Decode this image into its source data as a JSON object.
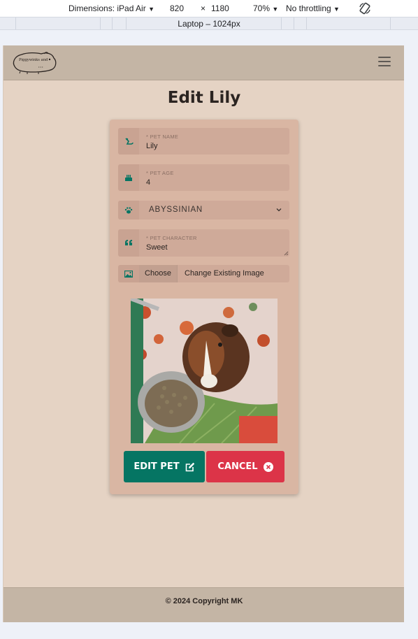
{
  "devtools": {
    "device": "Dimensions: iPad Air",
    "width": "820",
    "times": "×",
    "height": "1180",
    "zoom": "70%",
    "throttling": "No throttling",
    "media_label": "Laptop – 1024px"
  },
  "app": {
    "logo_text": "Piggywinks and",
    "title": "Edit Lily",
    "accent_color": "#057563",
    "danger_color": "#dc3448",
    "form": {
      "name_label": "* PET NAME",
      "name_value": "Lily",
      "age_label": "* PET AGE",
      "age_value": "4",
      "breed_selected": "ABYSSINIAN",
      "character_label": "* PET CHARACTER",
      "character_value": "Sweet",
      "choose_label": "Choose",
      "image_text": "Change Existing Image"
    },
    "photo_icon": "guinea-pig-photo",
    "edit_button": "EDIT PET",
    "cancel_button": "CANCEL",
    "footer_text": "© 2024 Copyright MK"
  }
}
